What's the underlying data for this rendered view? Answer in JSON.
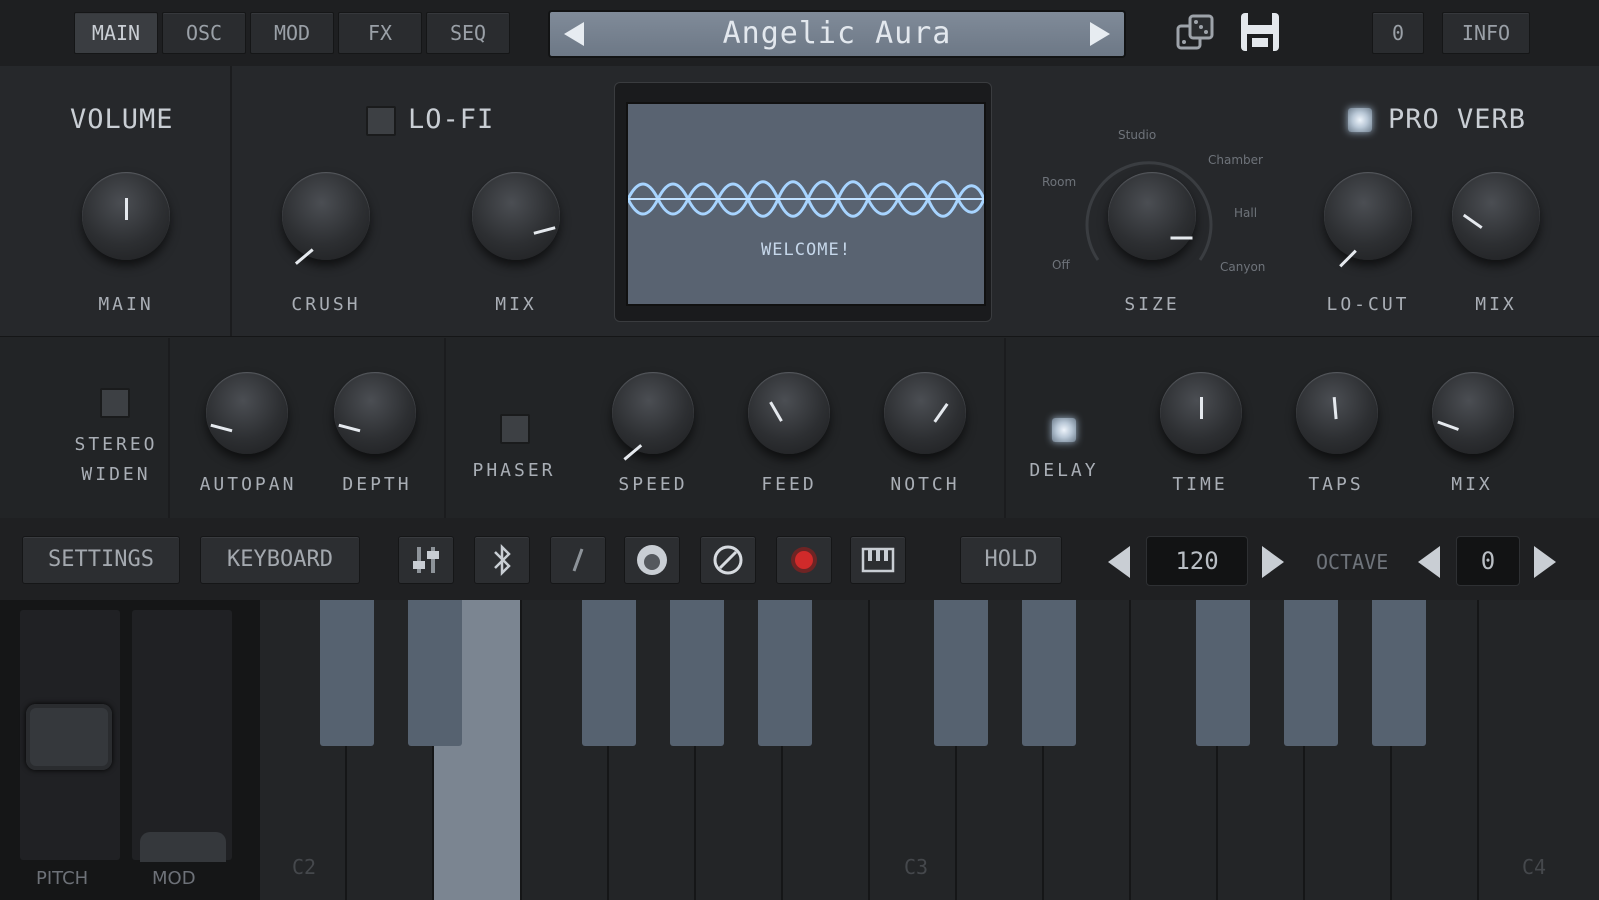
{
  "tabs": [
    "MAIN",
    "OSC",
    "MOD",
    "FX",
    "SEQ"
  ],
  "active_tab": "MAIN",
  "preset": {
    "name": "Angelic Aura"
  },
  "top_right": {
    "num_label": "0",
    "info_label": "INFO"
  },
  "volume": {
    "title": "VOLUME",
    "main_label": "MAIN"
  },
  "lofi": {
    "title": "LO-FI",
    "crush_label": "CRUSH",
    "mix_label": "MIX"
  },
  "display": {
    "message": "WELCOME!"
  },
  "reverb": {
    "title": "PRO VERB",
    "size_label": "SIZE",
    "locut_label": "LO-CUT",
    "mix_label": "MIX",
    "size_options": [
      "Off",
      "Room",
      "Studio",
      "Chamber",
      "Hall",
      "Canyon"
    ]
  },
  "stereo": {
    "label_line1": "STEREO",
    "label_line2": "WIDEN",
    "autopan_label": "AUTOPAN",
    "depth_label": "DEPTH"
  },
  "phaser": {
    "label": "PHASER",
    "speed_label": "SPEED",
    "feed_label": "FEED",
    "notch_label": "NOTCH"
  },
  "delay": {
    "label": "DELAY",
    "time_label": "TIME",
    "taps_label": "TAPS",
    "mix_label": "MIX"
  },
  "toolbar": {
    "settings_label": "SETTINGS",
    "keyboard_label": "KEYBOARD",
    "hold_label": "HOLD",
    "tempo": "120",
    "octave_label": "OCTAVE",
    "octave_value": "0"
  },
  "keyboard": {
    "note_labels": [
      "C2",
      "C3",
      "C4"
    ],
    "pitch_label": "PITCH",
    "mod_label": "MOD"
  },
  "colors": {
    "display_bg": "#596371",
    "waveform": "#a7d4ff",
    "key_black": "#566270",
    "key_pressed": "#7b8591"
  }
}
